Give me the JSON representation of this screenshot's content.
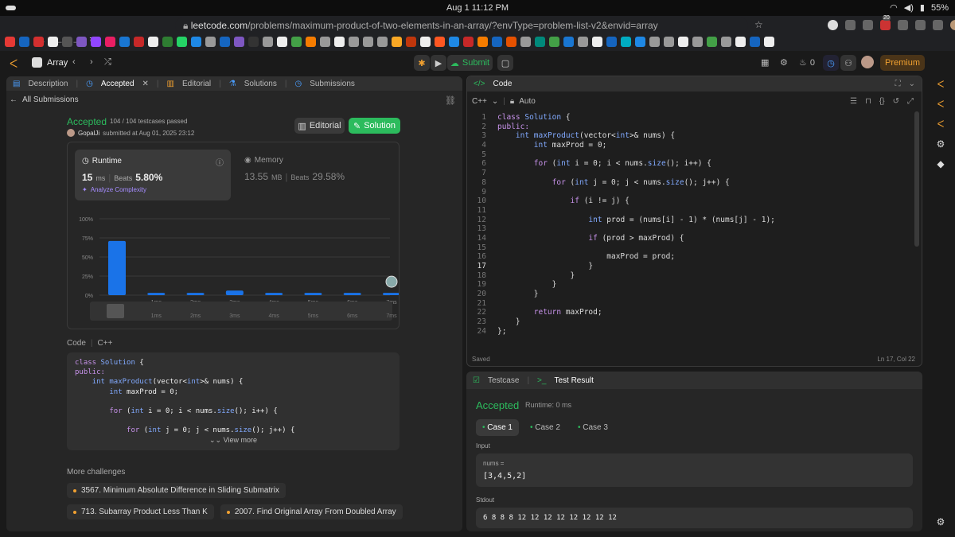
{
  "os": {
    "datetime": "Aug 1  11:12 PM",
    "battery": "55%"
  },
  "browser": {
    "url_host": "leetcode.com",
    "url_path": "/problems/maximum-product-of-two-elements-in-an-array/?envType=problem-list-v2&envid=array",
    "ext_badge": "20"
  },
  "lc": {
    "problem_list": "Array",
    "submit": "Submit",
    "streak": "0",
    "premium": "Premium"
  },
  "left": {
    "tabs": [
      "Description",
      "Accepted",
      "Editorial",
      "Solutions",
      "Submissions"
    ],
    "back": "All Submissions",
    "status": "Accepted",
    "passed": "104 / 104 testcases passed",
    "user": "GopalJi",
    "submitted": "submitted at Aug 01, 2025 23:12",
    "editorial_btn": "Editorial",
    "solution_btn": "Solution",
    "runtime_label": "Runtime",
    "runtime_value": "15",
    "runtime_unit": "ms",
    "beats_label": "Beats",
    "runtime_beats": "5.80%",
    "analyze": "Analyze Complexity",
    "memory_label": "Memory",
    "memory_value": "13.55",
    "memory_unit": "MB",
    "memory_beats": "29.58%",
    "code_label": "Code",
    "code_lang": "C++",
    "view_more": "View more",
    "more_challenges": "More challenges",
    "challenges": [
      "3567. Minimum Absolute Difference in Sliding Submatrix",
      "713. Subarray Product Less Than K",
      "2007. Find Original Array From Doubled Array"
    ]
  },
  "chart_data": {
    "type": "bar",
    "categories": [
      "",
      "1ms",
      "2ms",
      "3ms",
      "4ms",
      "5ms",
      "6ms",
      "7ms"
    ],
    "values": [
      71,
      3,
      3,
      6,
      3,
      3,
      3,
      3
    ],
    "yticks": [
      "100%",
      "75%",
      "50%",
      "25%",
      "0%"
    ],
    "ylim": [
      0,
      100
    ],
    "highlight_index": 7,
    "colors": {
      "bar": "#1a73e8"
    }
  },
  "editor": {
    "title": "Code",
    "lang": "C++",
    "mode": "Auto",
    "saved": "Saved",
    "cursor": "Ln 17, Col 22",
    "lines": [
      "class Solution {",
      "public:",
      "    int maxProduct(vector<int>& nums) {",
      "        int maxProd = 0;",
      "",
      "        for (int i = 0; i < nums.size(); i++) {",
      "",
      "            for (int j = 0; j < nums.size(); j++) {",
      "",
      "                if (i != j) {",
      "",
      "                    int prod = (nums[i] - 1) * (nums[j] - 1);",
      "",
      "                    if (prod > maxProd) {",
      "",
      "                        maxProd = prod;",
      "                    }",
      "                }",
      "            }",
      "        }",
      "",
      "        return maxProd;",
      "    }",
      "};"
    ],
    "current_line": 17
  },
  "preview_lines": [
    "class Solution {",
    "public:",
    "    int maxProduct(vector<int>& nums) {",
    "        int maxProd = 0;",
    "",
    "        for (int i = 0; i < nums.size(); i++) {",
    "",
    "            for (int j = 0; j < nums.size(); j++) {"
  ],
  "result": {
    "tab_testcase": "Testcase",
    "tab_result": "Test Result",
    "status": "Accepted",
    "runtime": "Runtime: 0 ms",
    "cases": [
      "Case 1",
      "Case 2",
      "Case 3"
    ],
    "input_label": "Input",
    "input_var": "nums =",
    "input_value": "[3,4,5,2]",
    "stdout_label": "Stdout",
    "stdout_value": "6 8 8 8 12 12 12 12 12 12 12 12"
  }
}
